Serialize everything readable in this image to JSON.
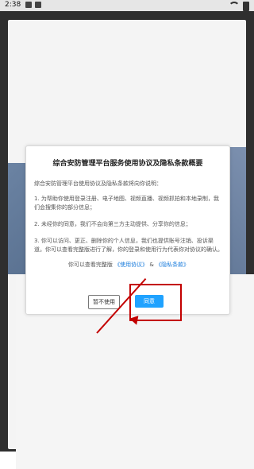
{
  "status_bar": {
    "time": "2:38"
  },
  "dialog": {
    "title": "综合安防管理平台服务使用协议及隐私条款概要",
    "intro": "综合安防管理平台使用协议及隐私条款将向你说明：",
    "points": [
      "1. 为帮助你使用登录注册、电子地图、视频直播、视频抓拍和本地录制，我们会搜集你的部分信息；",
      "2. 未经你的同意，我们不会向第三方主动提供、分享你的信息；",
      "3. 你可以访问、更正、删除你的个人信息，我们也提供账号注销、投诉渠道。你可以查看完整版进行了解，你的登录和使用行为代表你对协议的确认。"
    ],
    "links_prefix": "你可以查看完整版",
    "link_terms": "《使用协议》",
    "links_and": "&",
    "link_privacy": "《隐私条款》",
    "btn_decline": "暂不使用",
    "btn_agree": "同意"
  }
}
